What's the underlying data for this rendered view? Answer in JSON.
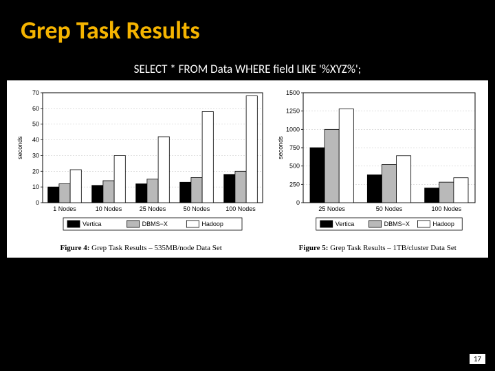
{
  "title": "Grep Task Results",
  "subtitle": "SELECT * FROM Data WHERE field LIKE '%XYZ%';",
  "page_number": "17",
  "legend_labels": {
    "vertica": "Vertica",
    "dbmsx": "DBMS−X",
    "hadoop": "Hadoop"
  },
  "captions": {
    "left_prefix": "Figure 4:",
    "left_text": " Grep Task Results – 535MB/node Data Set",
    "right_prefix": "Figure 5:",
    "right_text": " Grep Task Results – 1TB/cluster Data Set"
  },
  "chart_data": [
    {
      "id": "fig4",
      "type": "bar",
      "title": "",
      "xlabel": "",
      "ylabel": "seconds",
      "ylim": [
        0,
        70
      ],
      "yticks": [
        0,
        10,
        20,
        30,
        40,
        50,
        60,
        70
      ],
      "categories": [
        "1 Nodes",
        "10 Nodes",
        "25 Nodes",
        "50 Nodes",
        "100 Nodes"
      ],
      "series": [
        {
          "name": "Vertica",
          "fill": "#000000",
          "values": [
            10,
            11,
            12,
            13,
            18
          ]
        },
        {
          "name": "DBMS-X",
          "fill": "#b9b9b9",
          "values": [
            12,
            14,
            15,
            16,
            20
          ]
        },
        {
          "name": "Hadoop",
          "fill": "#ffffff",
          "values": [
            21,
            30,
            42,
            58,
            68
          ]
        }
      ]
    },
    {
      "id": "fig5",
      "type": "bar",
      "title": "",
      "xlabel": "",
      "ylabel": "seconds",
      "ylim": [
        0,
        1500
      ],
      "yticks": [
        0,
        250,
        500,
        750,
        1000,
        1250,
        1500
      ],
      "categories": [
        "25 Nodes",
        "50 Nodes",
        "100 Nodes"
      ],
      "series": [
        {
          "name": "Vertica",
          "fill": "#000000",
          "values": [
            750,
            380,
            200
          ]
        },
        {
          "name": "DBMS-X",
          "fill": "#b9b9b9",
          "values": [
            1000,
            520,
            280
          ]
        },
        {
          "name": "Hadoop",
          "fill": "#ffffff",
          "values": [
            1280,
            640,
            340
          ]
        }
      ]
    }
  ]
}
